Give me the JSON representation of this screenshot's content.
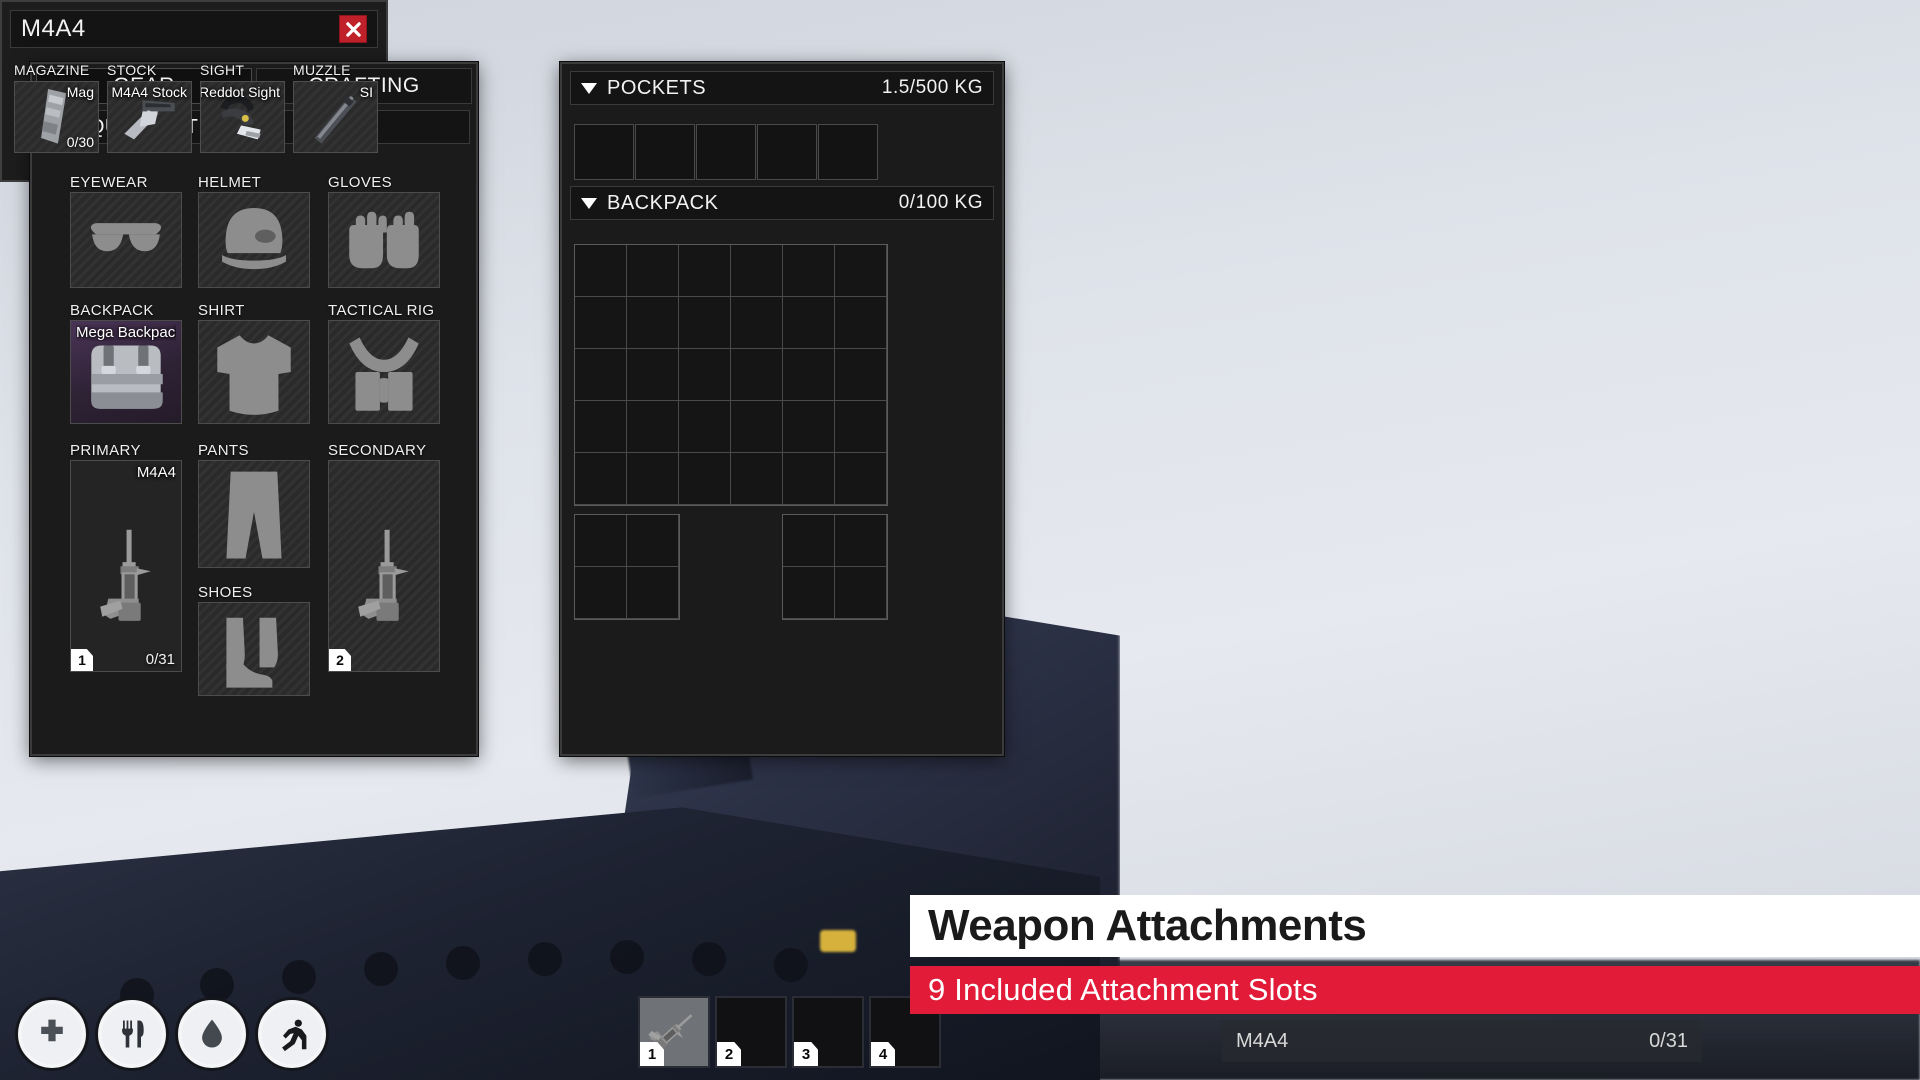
{
  "theme": {
    "accent_red": "#e11b38",
    "close_red": "#c0202a",
    "panel_bg": "#1b1b1b",
    "banner_white": "#ffffff"
  },
  "gear_panel": {
    "tabs": [
      {
        "label": "GEAR",
        "active": true
      },
      {
        "label": "CRAFTING",
        "active": false
      }
    ],
    "section": {
      "label": "EQUIPMENT",
      "expanded": true,
      "caret": "caret-down-icon"
    },
    "slots": [
      {
        "label": "EYEWEAR",
        "item": "",
        "ammo": "",
        "badge": "",
        "icon": "sunglasses-icon",
        "filled": false
      },
      {
        "label": "HELMET",
        "item": "",
        "ammo": "",
        "badge": "",
        "icon": "helmet-icon",
        "filled": false
      },
      {
        "label": "GLOVES",
        "item": "",
        "ammo": "",
        "badge": "",
        "icon": "gloves-icon",
        "filled": false
      },
      {
        "label": "BACKPACK",
        "item": "Mega Backpack",
        "ammo": "",
        "badge": "",
        "icon": "backpack-icon",
        "filled": true
      },
      {
        "label": "SHIRT",
        "item": "",
        "ammo": "",
        "badge": "",
        "icon": "shirt-icon",
        "filled": false
      },
      {
        "label": "TACTICAL RIG",
        "item": "",
        "ammo": "",
        "badge": "",
        "icon": "tactical-rig-icon",
        "filled": false
      },
      {
        "label": "PRIMARY",
        "item": "M4A4",
        "ammo": "0/31",
        "badge": "1",
        "icon": "rifle-icon",
        "filled": true
      },
      {
        "label": "PANTS",
        "item": "",
        "ammo": "",
        "badge": "",
        "icon": "pants-icon",
        "filled": false
      },
      {
        "label": "SECONDARY",
        "item": "",
        "ammo": "",
        "badge": "2",
        "icon": "rifle-icon",
        "filled": false
      },
      {
        "label": "SHOES",
        "item": "",
        "ammo": "",
        "badge": "",
        "icon": "boots-icon",
        "filled": false
      }
    ]
  },
  "inventory_panel": {
    "pockets": {
      "label": "POCKETS",
      "capacity": "1.5/500 KG",
      "expanded": true,
      "slot_count": 5
    },
    "backpack": {
      "label": "BACKPACK",
      "capacity": "0/100 KG",
      "expanded": true,
      "grid_cols": 6,
      "grid_rows": 5,
      "extra_grids": [
        {
          "cols": 2,
          "rows": 2
        },
        {
          "cols": 2,
          "rows": 2
        }
      ]
    }
  },
  "attachments_panel": {
    "title": "M4A4",
    "close_icon": "close-icon",
    "slots": [
      {
        "label": "MAGAZINE",
        "item": "Mag",
        "ammo": "0/30",
        "icon": "magazine-icon"
      },
      {
        "label": "STOCK",
        "item": "M4A4 Stock",
        "ammo": "",
        "icon": "stock-icon"
      },
      {
        "label": "SIGHT",
        "item": "Reddot Sight",
        "ammo": "",
        "icon": "reddot-sight-icon"
      },
      {
        "label": "MUZZLE",
        "item": "SI",
        "ammo": "",
        "icon": "suppressor-icon"
      }
    ]
  },
  "hud": {
    "status_icons": [
      {
        "name": "health-icon"
      },
      {
        "name": "food-icon"
      },
      {
        "name": "water-icon"
      },
      {
        "name": "stamina-icon"
      }
    ],
    "hotbar": [
      {
        "number": "1",
        "item": "M4A4",
        "active": true
      },
      {
        "number": "2",
        "item": "",
        "active": false
      },
      {
        "number": "3",
        "item": "",
        "active": false
      },
      {
        "number": "4",
        "item": "",
        "active": false
      }
    ],
    "weapon_readout": {
      "name": "M4A4",
      "ammo": "0/31"
    }
  },
  "banners": {
    "title": "Weapon Attachments",
    "subtitle": "9 Included Attachment Slots"
  }
}
